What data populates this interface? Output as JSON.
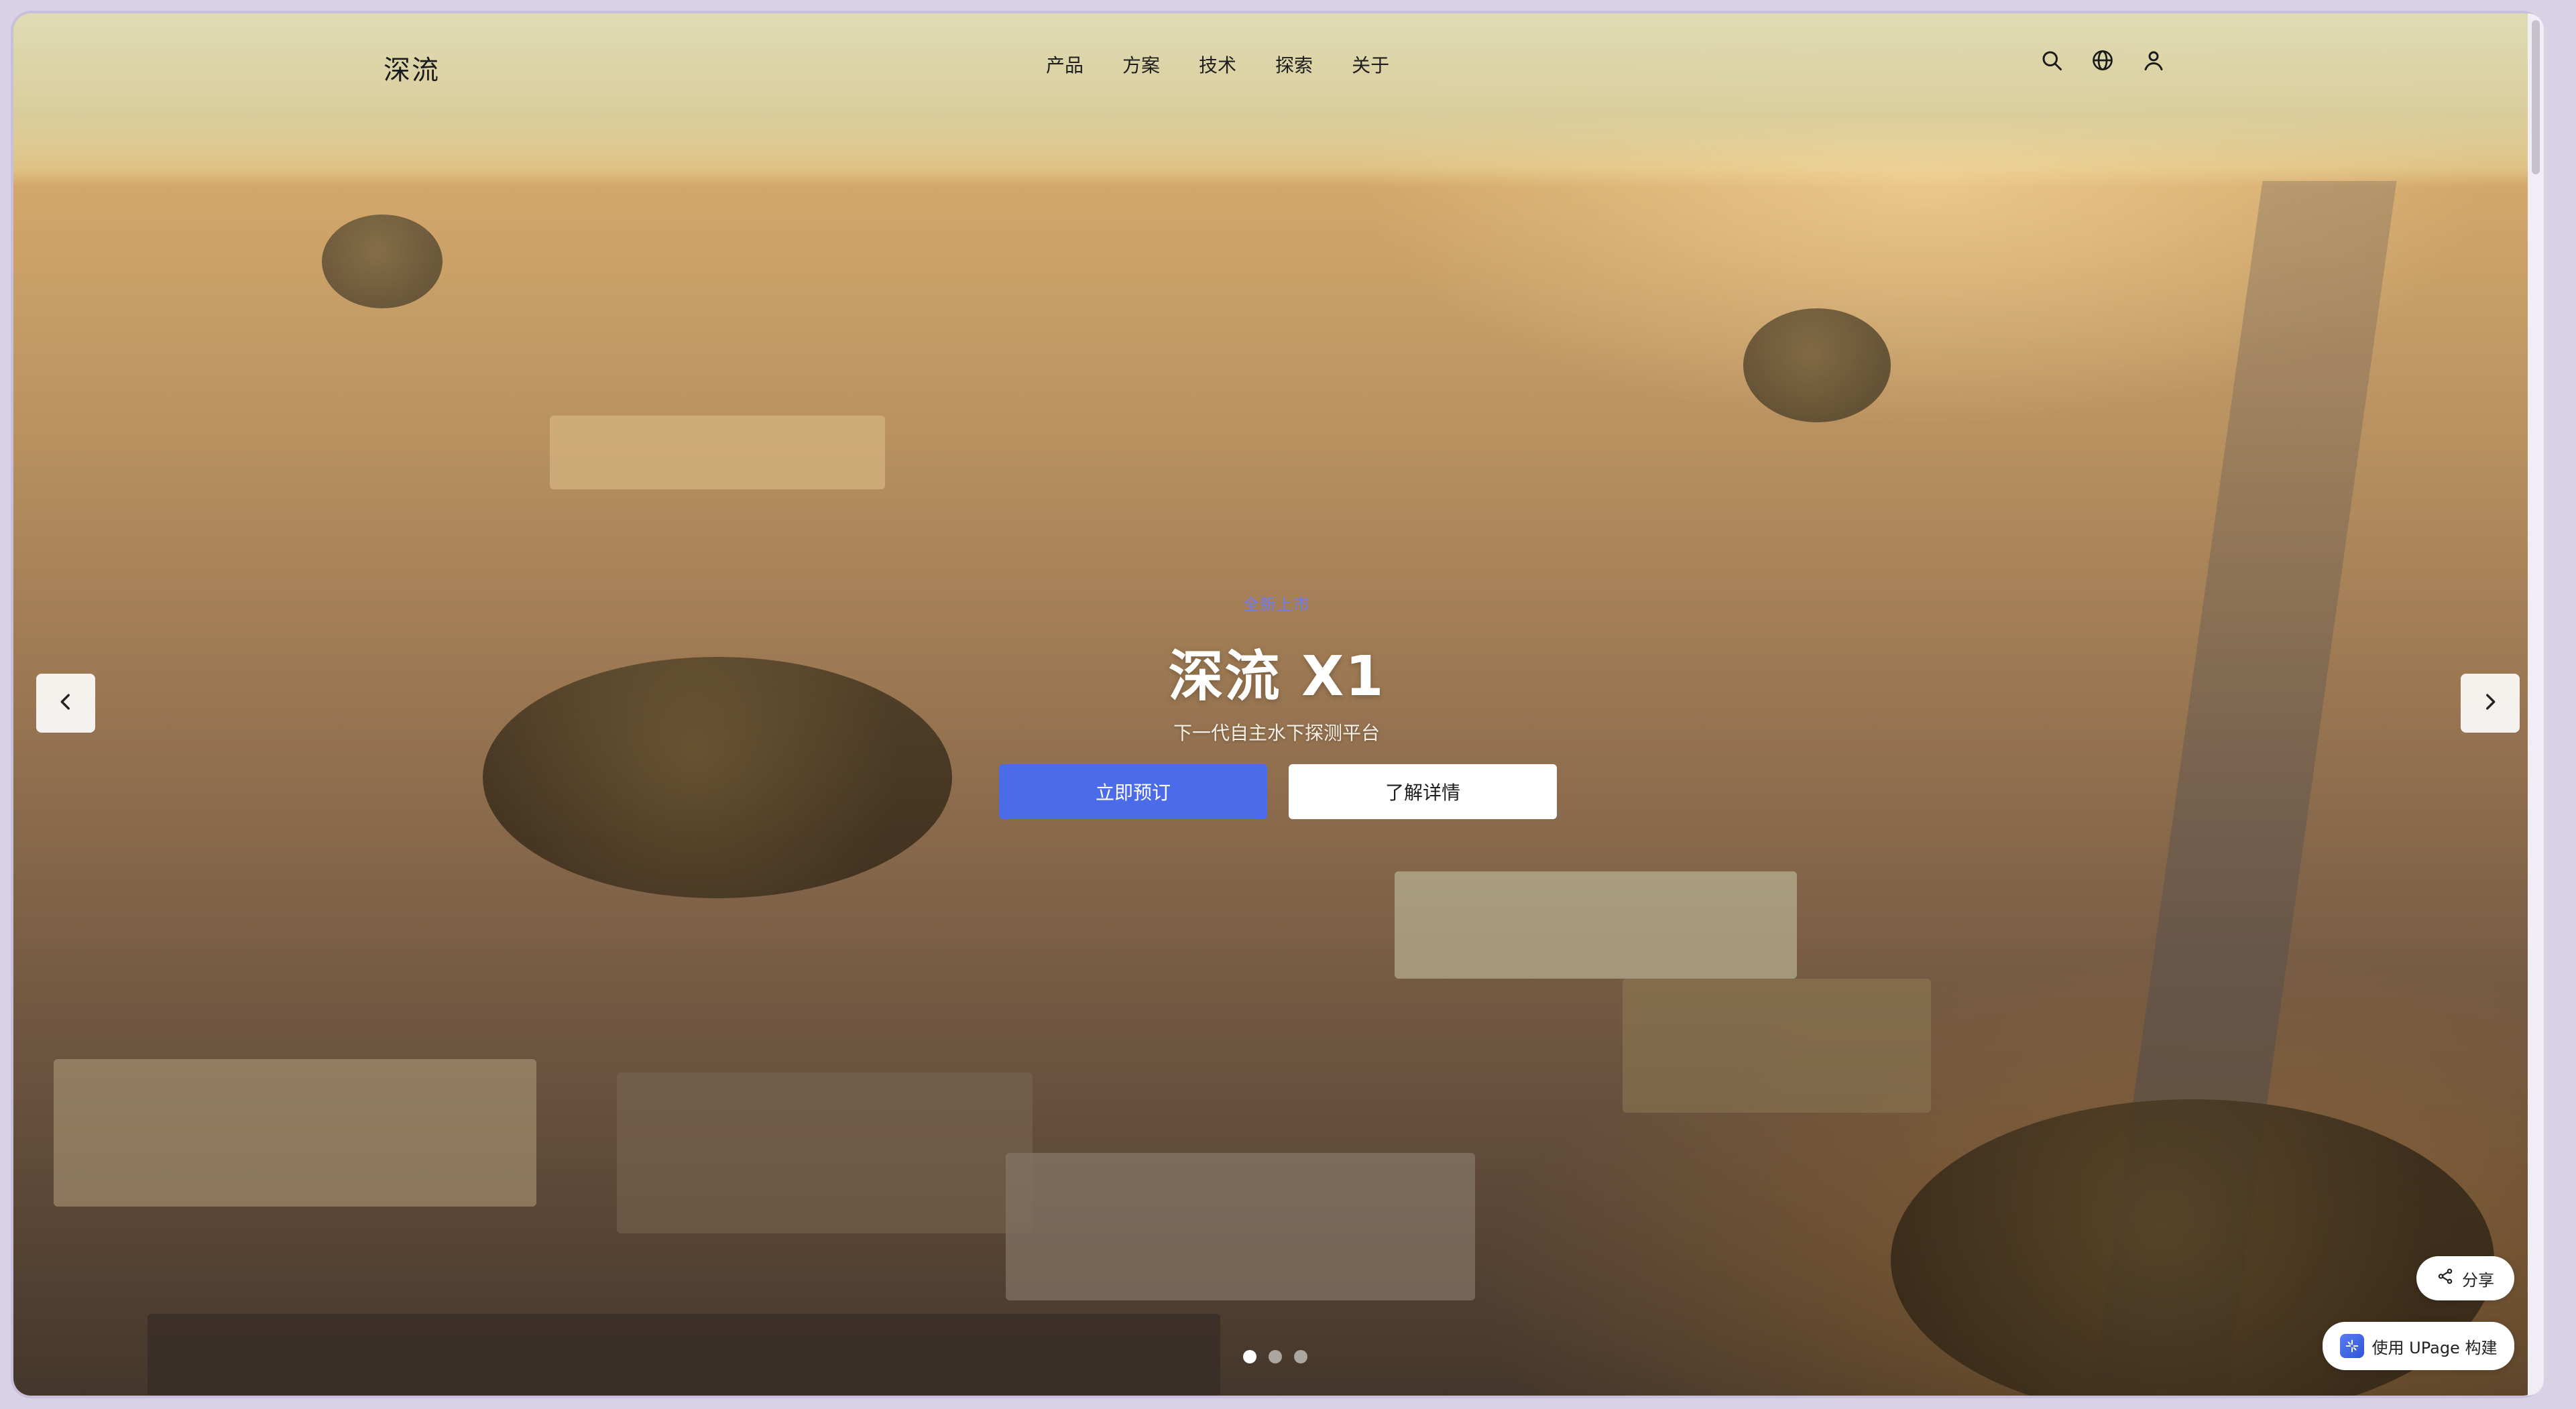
{
  "nav": {
    "brand": "深流",
    "menu": [
      {
        "label": "产品"
      },
      {
        "label": "方案"
      },
      {
        "label": "技术"
      },
      {
        "label": "探索"
      },
      {
        "label": "关于"
      }
    ],
    "icons": [
      "search-icon",
      "globe-icon",
      "user-icon"
    ]
  },
  "hero": {
    "eyebrow": "全新上市",
    "title": "深流 X1",
    "subtitle": "下一代自主水下探测平台",
    "primary_button": "立即预订",
    "secondary_button": "了解详情"
  },
  "carousel": {
    "slide_count": 3,
    "active_slide": 1,
    "prev_icon": "chevron-left-icon",
    "next_icon": "chevron-right-icon"
  },
  "floating": {
    "share_label": "分享",
    "upage_label": "使用 UPage 构建"
  },
  "colors": {
    "accent": "#4b6be8",
    "eyebrow": "#6f7cf0",
    "text_dark": "#1e1e1e",
    "text_light": "#ffffff"
  }
}
